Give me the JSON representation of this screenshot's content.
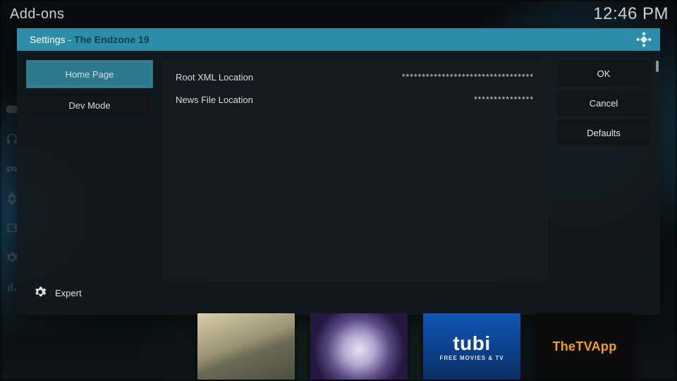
{
  "breadcrumb": "Add-ons",
  "clock": "12:46 PM",
  "dialog": {
    "title_prefix": "Settings - ",
    "addon_name": "The Endzone 19",
    "categories": [
      {
        "label": "Home Page",
        "active": true
      },
      {
        "label": "Dev Mode",
        "active": false
      }
    ],
    "level_label": "Expert",
    "settings": [
      {
        "label": "Root XML Location",
        "value": "*********************************"
      },
      {
        "label": "News File Location",
        "value": "***************"
      }
    ],
    "buttons": {
      "ok": "OK",
      "cancel": "Cancel",
      "defaults": "Defaults"
    }
  },
  "thumbs": {
    "tubi_main": "tubi",
    "tubi_sub": "FREE MOVIES & TV",
    "tvapp": "TheTVApp"
  },
  "left_rail_icons": [
    "video-icon",
    "headphones-icon",
    "game-icon",
    "addons-icon",
    "picture-icon",
    "configure-icon",
    "equalizer-icon"
  ]
}
